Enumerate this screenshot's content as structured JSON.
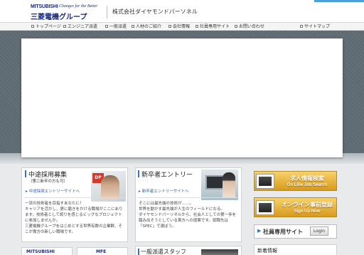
{
  "header": {
    "brand": "MITSUBISHI",
    "tagline": "Changes for the Better",
    "group_name": "三菱電機グループ",
    "company_name": "株式会社ダイヤモンドパーソネル"
  },
  "nav": {
    "items": [
      {
        "label": "トップページ"
      },
      {
        "label": "エンジニア派遣"
      },
      {
        "label": "一般派遣"
      },
      {
        "label": "人材のご紹介"
      },
      {
        "label": "会社情報"
      },
      {
        "label": "社員専用サイト"
      },
      {
        "label": "お問い合わせ"
      }
    ],
    "sitemap": "サイトマップ"
  },
  "cards": {
    "midcareer": {
      "title": "中途採用募集",
      "subtitle": "（第二新卒の方も可）",
      "badge": "DP",
      "link": "中途採用エントリーサイトへ",
      "lines": [
        "一流の技術者を目指すあなたに！",
        "キャリアを活かし、更に磨きをかける職場がここにあり",
        "ます。技術者として誇りを感じるビッグなプロジェクト",
        "に参加しませんか。",
        "三菱電機グループをはじめとする世界有数の企業群、そ",
        "こが貴方の新しい職場です。"
      ]
    },
    "newgrad": {
      "title": "新卒者エントリー",
      "link": "新卒者エントリーサイトへ",
      "lines": [
        "そこには最先端の技術が……。",
        "世界を動かす最先端が人生のフィールドになる。",
        "ダイヤモンドパーソネルから、社会人としての第一歩を",
        "踏み出そうとしている貴方への提案です。就職先は",
        "「SPEC」で選ぼう。"
      ]
    }
  },
  "banners": {
    "jobs": {
      "title": "求人情報検索",
      "subtitle": "On Line Job Search"
    },
    "online": {
      "title": "オンライン事前登録",
      "subtitle": "Sign Up Now"
    }
  },
  "staff_site": {
    "label": "社員専用サイト",
    "login": "Login"
  },
  "news": {
    "title": "新着情報"
  },
  "bottom": {
    "mini1": "MITSUBISHI",
    "mini2": "MFE",
    "dispatch_title": "一般派遣スタッフ"
  },
  "colors": {
    "brand_navy": "#1a2a7a",
    "accent_blue": "#3a72b8",
    "banner_gold": "#d79a1c",
    "hero_gray": "#5f6c74"
  }
}
